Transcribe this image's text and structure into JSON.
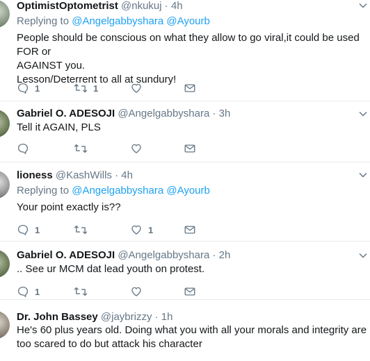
{
  "tweets": [
    {
      "name": "OptimistOptometrist",
      "handle": "@nkukuj",
      "time": "· 4h",
      "reply_prefix": "Replying to",
      "mentions": [
        "@Angelgabbyshara",
        "@Ayourb"
      ],
      "lines": [
        "People should be conscious on what they allow to go viral,it could be used FOR or",
        "AGAINST you.",
        "Lesson/Deterrent to all at sundury!"
      ],
      "reply_count": "1",
      "retweet_count": "1",
      "like_count": ""
    },
    {
      "name": "Gabriel O. ADESOJI",
      "handle": "@Angelgabbyshara",
      "time": "· 3h",
      "lines": [
        "Tell it AGAIN, PLS"
      ],
      "reply_count": "",
      "retweet_count": "",
      "like_count": ""
    },
    {
      "name": "lioness",
      "handle": "@KashWills",
      "time": "· 4h",
      "reply_prefix": "Replying to",
      "mentions": [
        "@Angelgabbyshara",
        "@Ayourb"
      ],
      "lines": [
        "Your point exactly is??"
      ],
      "reply_count": "1",
      "retweet_count": "",
      "like_count": "1"
    },
    {
      "name": "Gabriel O. ADESOJI",
      "handle": "@Angelgabbyshara",
      "time": "· 2h",
      "lines": [
        ".. See ur MCM dat lead youth on protest."
      ],
      "reply_count": "1",
      "retweet_count": "",
      "like_count": ""
    },
    {
      "name": "Dr. John Bassey",
      "handle": "@jaybrizzy",
      "time": "· 1h",
      "lines": [
        "He's 60 plus years old. Doing what you with all your morals and integrity are",
        "too scared to do but attack his character"
      ]
    }
  ],
  "icons": {
    "reply": "reply-icon",
    "retweet": "retweet-icon",
    "like": "heart-icon",
    "dm": "envelope-icon",
    "caret": "chevron-down-icon"
  },
  "colors": {
    "text": "#14171a",
    "muted": "#657786",
    "link": "#1da1f2",
    "divider": "#e6ecf0"
  }
}
